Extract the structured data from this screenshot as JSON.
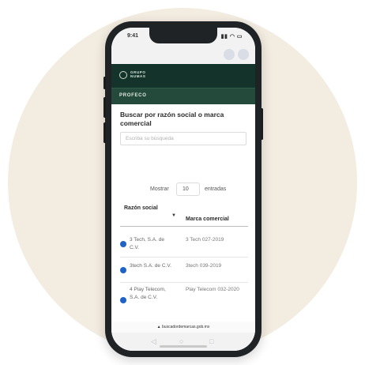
{
  "status_bar": {
    "time": "9:41",
    "icons": "▮▮ ◠ ▭"
  },
  "header": {
    "logo_line1": "GRUPO",
    "logo_line2": "NUMAS"
  },
  "subnav": {
    "link": "PROFECO"
  },
  "search": {
    "label": "Buscar por razón social o marca comercial",
    "placeholder": "Escriba su búsqueda"
  },
  "table": {
    "length_show": "Mostrar",
    "length_value": "10",
    "length_entries": "entradas",
    "columns": [
      "Razón social",
      "Marca comercial"
    ],
    "sort_indicator": "▼",
    "rows": [
      {
        "name": "3 Tech, S.A. de C.V.",
        "brand": "3 Tech 027-2019"
      },
      {
        "name": "3tech S.A. de C.V.",
        "brand": "3tech 039-2019"
      },
      {
        "name": "4 Play Telecom, S.A. de C.V.",
        "brand": "Play Telecom 032-2020"
      }
    ]
  },
  "browser": {
    "url": "▲ buscadordemarcas.gob.mx"
  },
  "bottom_nav": {
    "back": "◁",
    "home": "○",
    "recent": "□"
  },
  "colors": {
    "header_bg": "#14332a",
    "subnav_bg": "#234a3a",
    "accent_dot": "#1f63c7",
    "background_circle": "#f3ece0"
  }
}
